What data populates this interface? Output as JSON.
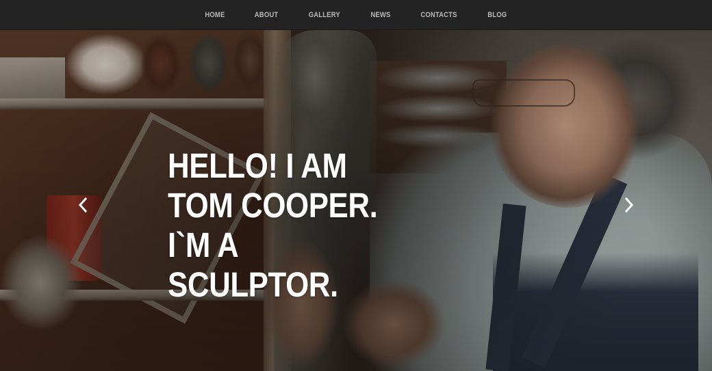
{
  "nav": {
    "items": [
      {
        "label": "HOME"
      },
      {
        "label": "ABOUT"
      },
      {
        "label": "GALLERY"
      },
      {
        "label": "NEWS"
      },
      {
        "label": "CONTACTS"
      },
      {
        "label": "BLOG"
      }
    ]
  },
  "hero": {
    "title": "HELLO! I AM TOM COOPER. I`M A SCULPTOR.",
    "prev_icon": "chevron-left-icon",
    "next_icon": "chevron-right-icon"
  },
  "colors": {
    "navbar_bg": "#232323",
    "nav_text": "#b9b9b9",
    "hero_text": "#ffffff"
  }
}
